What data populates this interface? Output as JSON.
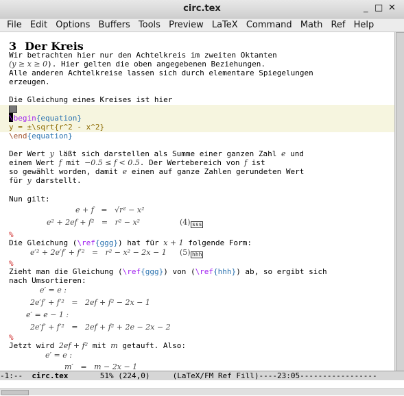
{
  "window": {
    "title": "circ.tex"
  },
  "menu": [
    "File",
    "Edit",
    "Options",
    "Buffers",
    "Tools",
    "Preview",
    "LaTeX",
    "Command",
    "Math",
    "Ref",
    "Help"
  ],
  "heading": {
    "number": "3",
    "text": "Der Kreis"
  },
  "para1": [
    "Wir betrachten hier nur den Achtelkreis im zweiten Oktanten",
    "). Hier gelten die oben angegebenen Beziehungen.",
    "Alle anderen Achtelkreise lassen sich durch elementare Spiegelungen",
    "erzeugen."
  ],
  "para1_math": "(y ≥ x ≥ 0",
  "line_circle": "Die Gleichung eines Kreises ist hier",
  "env": {
    "begin_kw": "\\begin",
    "begin_arg": "{equation}",
    "formula": "y = ±\\sqrt{r^2 - x^2}",
    "end_kw": "\\end",
    "end_arg": "{equation}"
  },
  "para2": {
    "l1a": "Der Wert ",
    "l1m": "y",
    "l1b": " läßt sich darstellen als Summe einer ganzen Zahl ",
    "l1m2": "e",
    "l1c": " und",
    "l2a": "einem Wert ",
    "l2m": "f",
    "l2b": " mit ",
    "l2m2": "−0.5 ≤ f < 0.5",
    "l2c": ". Der Wertebereich von ",
    "l2m3": "f",
    "l2d": " ist",
    "l3a": "so gewählt worden, damit ",
    "l3m": "e",
    "l3b": " einen auf ganze Zahlen gerundeten Wert",
    "l4a": "für ",
    "l4m": "y",
    "l4b": " darstellt."
  },
  "nun": "Nun gilt:",
  "eq1a": "e + f   =   √r² − x²",
  "eq1b": "e² + 2ef + f²   =   r² − x²",
  "eq1_num": "(4)",
  "tag_sss": "sss",
  "percent": "%",
  "form_line": {
    "a": "Die Gleichung (",
    "kw": "\\ref",
    "arg": "{ggg}",
    "b": ") hat für ",
    "m": "x + 1",
    "c": " folgende Form:"
  },
  "eq2": "e′² + 2e′f′ + f′²   =   r² − x² − 2x − 1",
  "eq2_num": "(5)",
  "tag_hhh": "hhh",
  "zieht": {
    "a": "Zieht man die Gleichung (",
    "kw1": "\\ref",
    "arg1": "{ggg}",
    "b": ") von (",
    "kw2": "\\ref",
    "arg2": "{hhh}",
    "c": ") ab, so ergibt sich",
    "d": "nach Umsortieren:"
  },
  "eq3": [
    "e′ = e :",
    "2e′f′ + f′²   =   2ef + f² − 2x − 1",
    "e′ = e − 1 :",
    "2e′f′ + f′²   =   2ef + f² + 2e − 2x − 2"
  ],
  "jetzt": {
    "a": "Jetzt wird ",
    "m1": "2ef + f²",
    "b": " mit ",
    "m2": "m",
    "c": " getauft. Also:"
  },
  "eq4": [
    "e′ = e :",
    "m′   =   m − 2x − 1"
  ],
  "modeline": {
    "a": "-1:--  ",
    "buf": "circ.tex",
    "b": "       51% (224,0)     (LaTeX/FM Ref Fill)----23:05-----------------"
  }
}
